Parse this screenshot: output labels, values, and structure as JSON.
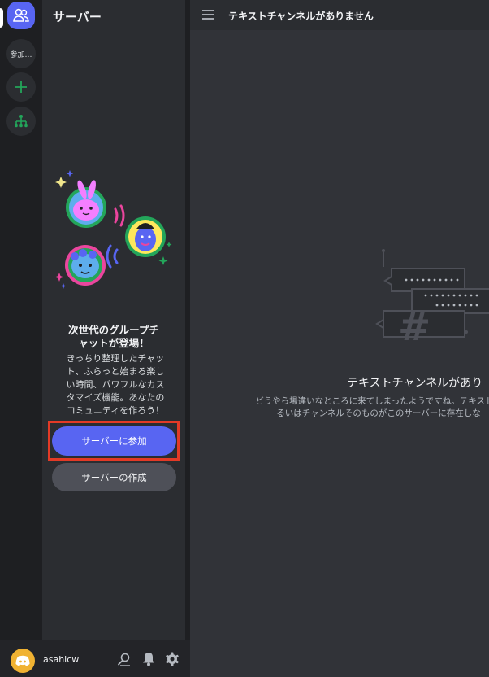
{
  "rail": {
    "join_label": "参加…"
  },
  "panel": {
    "title": "サーバー",
    "promo_title_1": "次世代のグループチ",
    "promo_title_2": "ャットが登場！",
    "promo_body_1": "きっちり整理したチャッ",
    "promo_body_2": "ト、ふらっと始まる楽し",
    "promo_body_3": "い時間、パワフルなカス",
    "promo_body_4": "タマイズ機能。あなたの",
    "promo_body_5": "コミュニティを作ろう！",
    "join_button": "サーバーに参加",
    "create_button": "サーバーの作成"
  },
  "user": {
    "name": "asahicw"
  },
  "main": {
    "topbar_title": "テキストチャンネルがありません",
    "empty_title": "テキストチャンネルがあり",
    "empty_sub_1": "どうやら場違いなところに来てしまったようですね。テキストチ",
    "empty_sub_2": "るいはチャンネルそのものがこのサーバーに存在しな"
  },
  "colors": {
    "accent": "#5865f2",
    "highlight": "#e33a26",
    "green": "#23a55a",
    "avatar": "#f0b232"
  },
  "icons": [
    "friends-icon",
    "add-server-icon",
    "explore-icon",
    "menu-icon",
    "user-search-icon",
    "bell-icon",
    "gear-icon",
    "discord-logo-icon"
  ]
}
